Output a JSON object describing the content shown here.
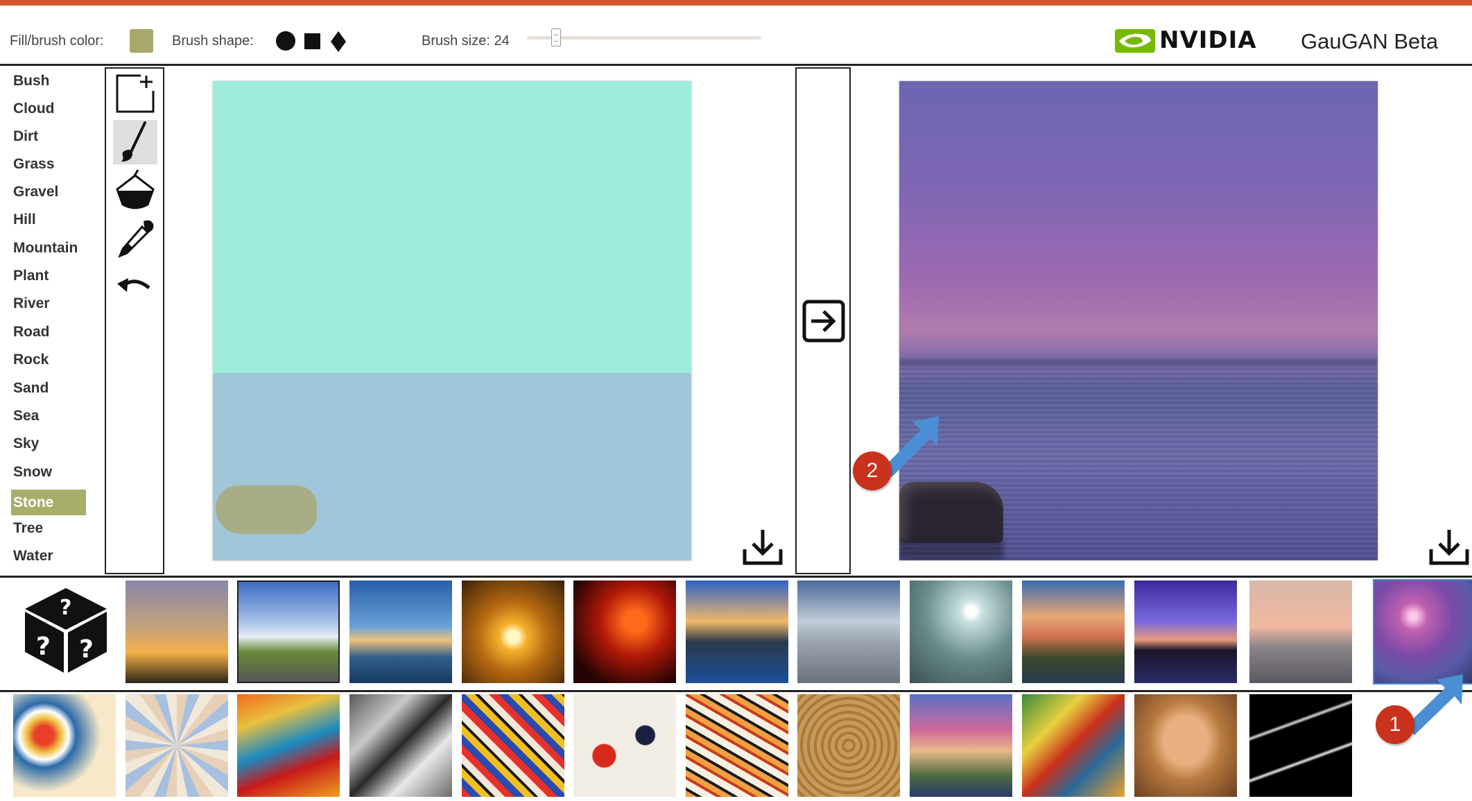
{
  "toolbar": {
    "fill_label": "Fill/brush color:",
    "fill_color": "#a8a86a",
    "shape_label": "Brush shape:",
    "shapes": [
      "circle-icon",
      "square-icon",
      "diamond-icon"
    ],
    "size_label": "Brush size: 24",
    "brush_size": 24
  },
  "brand": {
    "logo_icon": "nvidia-eye-logo",
    "word": "NVIDIA",
    "product": "GauGAN Beta",
    "accent": "#76b900"
  },
  "labels": {
    "items": [
      "Bush",
      "Cloud",
      "Dirt",
      "Grass",
      "Gravel",
      "Hill",
      "Mountain",
      "Plant",
      "River",
      "Road",
      "Rock",
      "Sand",
      "Sea",
      "Sky",
      "Snow",
      "Stone",
      "Tree",
      "Water"
    ],
    "selected": "Stone",
    "selected_color": "#a8ad6a"
  },
  "tools": [
    "new-canvas-icon",
    "brush-icon",
    "paint-bucket-icon",
    "eyedropper-icon",
    "undo-icon"
  ],
  "canvas": {
    "sky_color": "#9eecdc",
    "sea_color": "#9fc6d9",
    "stone_color": "#a8ad86"
  },
  "style_row1": [
    "random-dice-icon",
    "sunset-trees",
    "road-clouds",
    "coast-blue",
    "golden-sunset",
    "red-sky",
    "cliff-sea",
    "grey-beach",
    "moon-shore",
    "orange-clouds",
    "purple-dusk",
    "pink-sea",
    "purple-sunset-selected"
  ],
  "style_row2": [
    "abstract-circles",
    "stained-glass",
    "rain-umbrella",
    "cubist-grey",
    "kandinsky",
    "handprint",
    "graffiti",
    "wood-rings",
    "matisse-hat",
    "picasso-still",
    "picasso-portrait",
    "black-marble"
  ],
  "annotations": {
    "one": "1",
    "two": "2",
    "color": "#c9321c",
    "arrow_color": "#4a8fd4"
  }
}
